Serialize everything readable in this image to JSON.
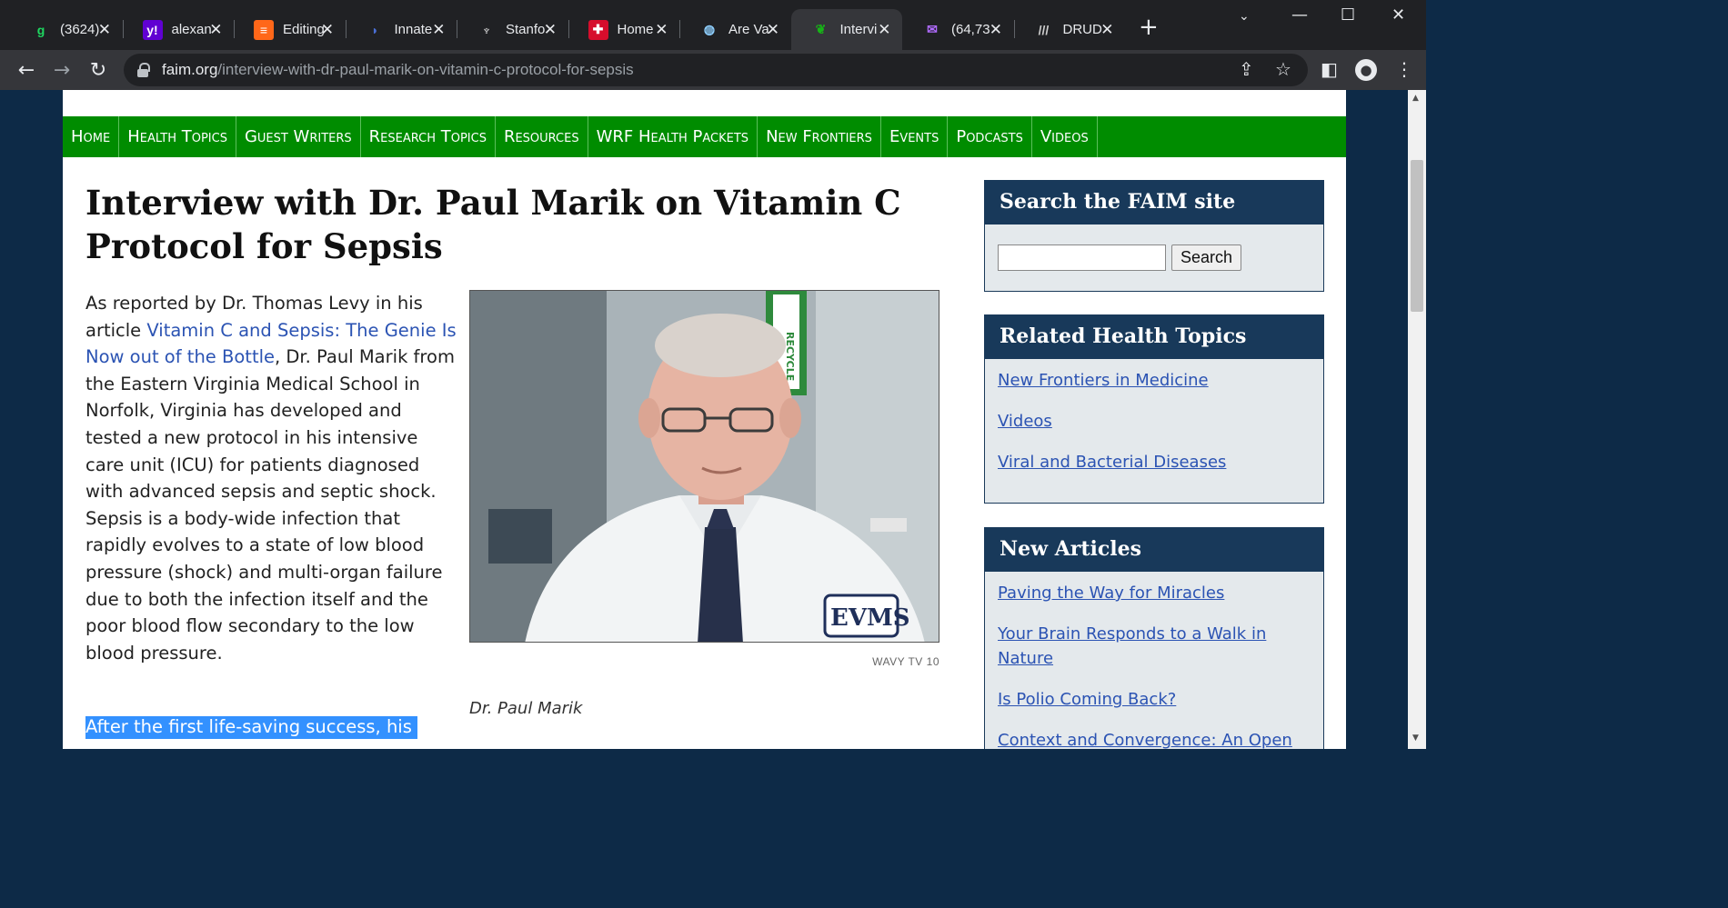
{
  "browser": {
    "tabs": [
      {
        "title": "(3624)",
        "favicon": "g-icon",
        "glyph": "g",
        "color": "#1ed760",
        "bg": "transparent"
      },
      {
        "title": "alexan",
        "favicon": "yahoo-mail-icon",
        "glyph": "y!",
        "color": "#ffffff",
        "bg": "#6001d2"
      },
      {
        "title": "Editing",
        "favicon": "substack-icon",
        "glyph": "≡",
        "color": "#ffffff",
        "bg": "#ff6719"
      },
      {
        "title": "Innate",
        "favicon": "page-icon",
        "glyph": "◗",
        "color": "#4a6fd6",
        "bg": "transparent"
      },
      {
        "title": "Stanfo",
        "favicon": "stanford-icon",
        "glyph": "♆",
        "color": "#ffffff",
        "bg": "transparent"
      },
      {
        "title": "Home",
        "favicon": "home-site-icon",
        "glyph": "✚",
        "color": "#ffffff",
        "bg": "#d60d2c"
      },
      {
        "title": "Are Va",
        "favicon": "globe-icon",
        "glyph": "◍",
        "color": "#8fd0ff",
        "bg": "transparent"
      },
      {
        "title": "Intervi",
        "favicon": "faim-leaf-icon",
        "glyph": "❦",
        "color": "#17b317",
        "bg": "transparent"
      },
      {
        "title": "(64,73",
        "favicon": "mail-icon",
        "glyph": "✉",
        "color": "#b06bff",
        "bg": "transparent"
      },
      {
        "title": "DRUD",
        "favicon": "drudge-icon",
        "glyph": "///",
        "color": "#cfcfcf",
        "bg": "transparent"
      }
    ],
    "active_tab": 7,
    "url_host": "faim.org",
    "url_path": "/interview-with-dr-paul-marik-on-vitamin-c-protocol-for-sepsis"
  },
  "nav": {
    "items": [
      "Home",
      "Health Topics",
      "Guest Writers",
      "Research Topics",
      "Resources",
      "WRF Health Packets",
      "New Frontiers",
      "Events",
      "Podcasts",
      "Videos"
    ]
  },
  "article": {
    "title": "Interview with Dr. Paul Marik on Vitamin C Protocol for Sepsis",
    "intro_before_link": "As reported by Dr. Thomas Levy in his article ",
    "link_text": "Vitamin C and Sepsis: The Genie Is Now out of the Bottle",
    "intro_after_link": ", Dr. Paul Marik from the Eastern Virginia Medical School in Norfolk, Virginia has developed and tested a new protocol in his intensive care unit (ICU) for patients diagnosed with advanced sepsis and septic shock. Sepsis is a body-wide infection that rapidly evolves to a state of low blood pressure (shock) and multi-organ failure due to both the infection itself and the poor blood flow secondary to the low blood pressure.",
    "highlighted_text": "After the first life-saving success, his",
    "photo_credit": "WAVY TV 10",
    "photo_caption": "Dr. Paul Marik",
    "photo_badge": "EVMS",
    "photo_sign": "RECYCLE"
  },
  "sidebar": {
    "search": {
      "title": "Search the FAIM site",
      "button": "Search",
      "value": ""
    },
    "related": {
      "title": "Related Health Topics",
      "links": [
        "New Frontiers in Medicine",
        "Videos",
        "Viral and Bacterial Diseases"
      ]
    },
    "new_articles": {
      "title": "New Articles",
      "links": [
        "Paving the Way for Miracles",
        "Your Brain Responds to a Walk in Nature",
        "Is Polio Coming Back?",
        "Context and Convergence: An Open"
      ]
    }
  }
}
